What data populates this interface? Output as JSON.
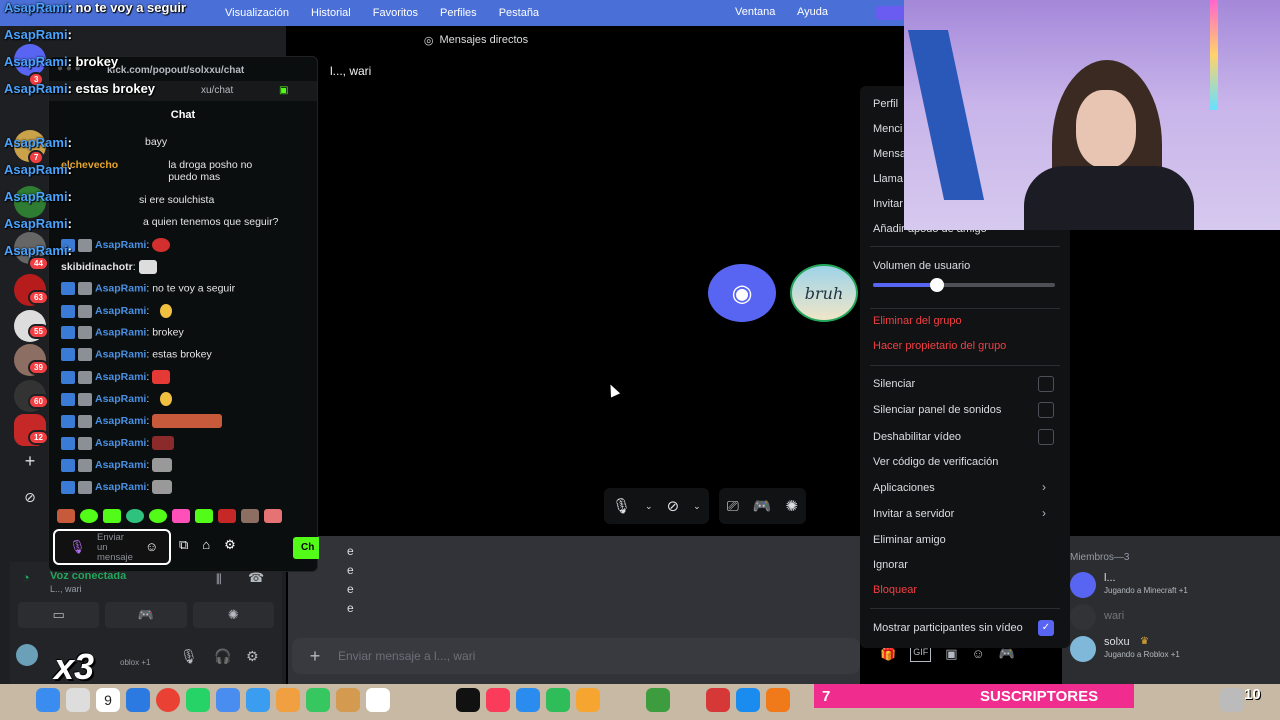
{
  "menubar": {
    "items": [
      "Visualización",
      "Historial",
      "Favoritos",
      "Perfiles",
      "Pestaña"
    ],
    "right_items": [
      "Ventana",
      "Ayuda"
    ]
  },
  "overlay_chat": [
    {
      "name": "AsapRami",
      "text": "no te voy a seguir"
    },
    {
      "name": "AsapRami",
      "text": ":"
    },
    {
      "name": "AsapRami",
      "text": "brokey"
    },
    {
      "name": "AsapRami",
      "text": "estas brokey"
    },
    {
      "name": "AsapRami",
      "text": ":"
    },
    {
      "name": "AsapRami",
      "text": ":"
    },
    {
      "name": "AsapRami",
      "text": ":"
    },
    {
      "name": "AsapRami",
      "text": ":"
    },
    {
      "name": "AsapRami",
      "text": ":"
    }
  ],
  "server_badges": [
    "3",
    "7",
    "44",
    "63",
    "55",
    "39",
    "60",
    "12"
  ],
  "kick_popout": {
    "url": "kick.com/popout/solxxu/chat",
    "url2": "xu/chat",
    "title": "Chat",
    "messages": [
      {
        "user": "",
        "text": "bayy"
      },
      {
        "user": "elchevecho",
        "text": "la droga posho no puedo mas"
      },
      {
        "user": "",
        "text": "si ere soulchista"
      },
      {
        "user": "",
        "text": "a quien tenemos que seguir?"
      },
      {
        "user": "AsapRami",
        "text": ""
      },
      {
        "user": "skibidinachotr",
        "text": ""
      },
      {
        "user": "AsapRami",
        "text": "no te voy a seguir"
      },
      {
        "user": "AsapRami",
        "text": ""
      },
      {
        "user": "AsapRami",
        "text": "brokey"
      },
      {
        "user": "AsapRami",
        "text": "estas brokey"
      },
      {
        "user": "AsapRami",
        "text": ""
      },
      {
        "user": "AsapRami",
        "text": ""
      },
      {
        "user": "AsapRami",
        "text": ""
      },
      {
        "user": "AsapRami",
        "text": ""
      },
      {
        "user": "AsapRami",
        "text": ""
      },
      {
        "user": "AsapRami",
        "text": ""
      }
    ],
    "input_placeholder": "Enviar un mensaje",
    "send_label": "Ch"
  },
  "voice": {
    "title": "Voz conectada",
    "subtitle": "L.., wari",
    "user_status": "oblox +1"
  },
  "dm": {
    "header": "Mensajes directos",
    "group_name": "l..., wari",
    "chat_lines": [
      "e",
      "e",
      "e",
      "e"
    ],
    "composer_placeholder": "Enviar mensaje a l..., wari"
  },
  "members": {
    "title": "Miembros—3",
    "list": [
      {
        "name": "l...",
        "activity": "Jugando a Minecraft +1",
        "color": "#5865f2"
      },
      {
        "name": "wari",
        "activity": "",
        "color": "#3a3c42"
      },
      {
        "name": "solxu",
        "activity": "Jugando a Roblox +1",
        "color": "#7fb8d9"
      }
    ]
  },
  "context_menu": {
    "perfil": "Perfil",
    "menc": "Menci",
    "mensa": "Mensa",
    "llama": "Llama",
    "invitar": "Invitar",
    "apodo": "Añadir apodo de amigo",
    "volume_label": "Volumen de usuario",
    "volume_percent": 35,
    "eliminar_grupo": "Eliminar del grupo",
    "propietario": "Hacer propietario del grupo",
    "silenciar": "Silenciar",
    "silenciar_sonidos": "Silenciar panel de sonidos",
    "deshabilitar_video": "Deshabilitar vídeo",
    "codigo": "Ver código de verificación",
    "aplicaciones": "Aplicaciones",
    "invitar_servidor": "Invitar a servidor",
    "eliminar_amigo": "Eliminar amigo",
    "ignorar": "Ignorar",
    "bloquear": "Bloquear",
    "mostrar": "Mostrar participantes sin vídeo"
  },
  "call": {
    "avatar2_text": "bruh"
  },
  "subs_bar": {
    "count": "7",
    "label": "SUSCRIPTORES",
    "goal": "10"
  },
  "overlay_text": "x3",
  "dock_calendar_day": "9",
  "colors": {
    "blurple": "#5865f2",
    "danger": "#f23f43",
    "kick_green": "#53fc18",
    "subs_pink": "#f02c8e",
    "voice_green": "#23a55a"
  }
}
